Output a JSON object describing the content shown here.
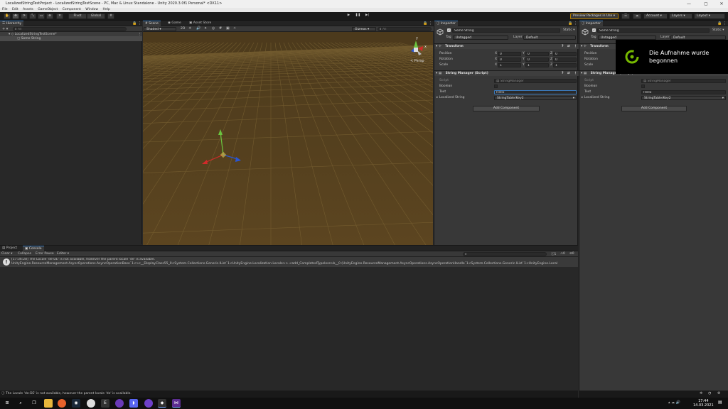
{
  "window": {
    "title": "LocalizedStringTestProject - LocalizedStringTestScene - PC, Mac & Linux Standalone - Unity 2020.3.0f1 Personal* <DX11>",
    "minimize": "—",
    "maximize": "▢",
    "close": "✕"
  },
  "menu": [
    "File",
    "Edit",
    "Assets",
    "GameObject",
    "Component",
    "Window",
    "Help"
  ],
  "toolbar": {
    "pivot": "Pivot",
    "global": "Global",
    "preview_packages": "Preview Packages in Use ▾",
    "account": "Account",
    "layers": "Layers",
    "layout": "Layout"
  },
  "hierarchy": {
    "tab": "Hierarchy",
    "add": "+ ▾",
    "search_placeholder": "All",
    "scene_name": "LocalizedStringTestScene*",
    "object": "Some String"
  },
  "scene_view": {
    "tabs": [
      "Scene",
      "Game",
      "Asset Store"
    ],
    "shading": "Shaded",
    "mode_2d": "2D",
    "gizmos": "Gizmos ▾",
    "search_placeholder": "All",
    "persp": "< Persp",
    "axis_y": "y",
    "axis_x": "x"
  },
  "inspector1": {
    "tab": "Inspector",
    "name": "Some String",
    "static": "Static ▾",
    "tag_label": "Tag",
    "tag": "Untagged",
    "layer_label": "Layer",
    "layer": "Default",
    "transform": {
      "title": "Transform",
      "rows": [
        {
          "label": "Position",
          "x": "0",
          "y": "0",
          "z": "0"
        },
        {
          "label": "Rotation",
          "x": "0",
          "y": "0",
          "z": "0"
        },
        {
          "label": "Scale",
          "x": "1",
          "y": "1",
          "z": "1"
        }
      ]
    },
    "string_manager": {
      "title": "String Manager (Script)",
      "script_label": "Script",
      "script": "StringManager",
      "bool_label": "Boolean",
      "text_label": "Text",
      "text": "Hello",
      "loc_label": "Localized String",
      "loc": "StringTable/Key2"
    },
    "add_component": "Add Component"
  },
  "inspector2": {
    "tab": "Inspector",
    "name": "Some String",
    "static": "Static ▾",
    "tag_label": "Tag",
    "tag": "Untagged",
    "layer_label": "Layer",
    "layer": "Default",
    "transform": {
      "title": "Transform",
      "rows": [
        {
          "label": "Position",
          "x": "0",
          "y": "0",
          "z": "0"
        },
        {
          "label": "Rotation",
          "x": "0",
          "y": "0",
          "z": "0"
        },
        {
          "label": "Scale",
          "x": "1",
          "y": "1",
          "z": "1"
        }
      ]
    },
    "string_manager": {
      "title": "String Manager (Script)",
      "script_label": "Script",
      "script": "StringManager",
      "bool_label": "Boolean",
      "text_label": "Text",
      "text": "Hello",
      "loc_label": "Localized String",
      "loc": "StringTable/Key2"
    },
    "add_component": "Add Component"
  },
  "recording_toast": {
    "line1": "Die Aufnahme wurde",
    "line2": "begonnen"
  },
  "console": {
    "tabs": [
      "Project",
      "Console"
    ],
    "clear": "Clear ▾",
    "collapse": "Collapse",
    "error_pause": "Error Pause",
    "editor": "Editor ▾",
    "count_info": "1",
    "count_warn": "0",
    "count_error": "0",
    "entry_line1": "[17:36:28] The Locale 'de-DE' is not available, however the parent locale 'de' is available.",
    "entry_line2": "UnityEngine.ResourceManagement.AsyncOperations.AsyncOperationBase`1<>c__DisplayClass55_0<System.Collections.Generic.IList`1<UnityEngine.Localization.Locale>>.<add_CompletedTypeless>b__0 (UnityEngine.ResourceManagement.AsyncOperations.AsyncOperationHandle`1<System.Collections.Generic.IList`1<UnityEngine.Local"
  },
  "status_bar": "The Locale 'de-DE' is not available, however the parent locale 'de' is available.",
  "taskbar": {
    "time": "17:44",
    "date": "14.03.2021",
    "icons": [
      "start-icon",
      "search-icon",
      "task-view-icon",
      "file-explorer-icon",
      "firefox-icon",
      "steam-icon",
      "chrome-icon",
      "epic-games-icon",
      "obs-icon",
      "discord-icon",
      "github-icon",
      "unity-icon",
      "visual-studio-icon"
    ]
  }
}
